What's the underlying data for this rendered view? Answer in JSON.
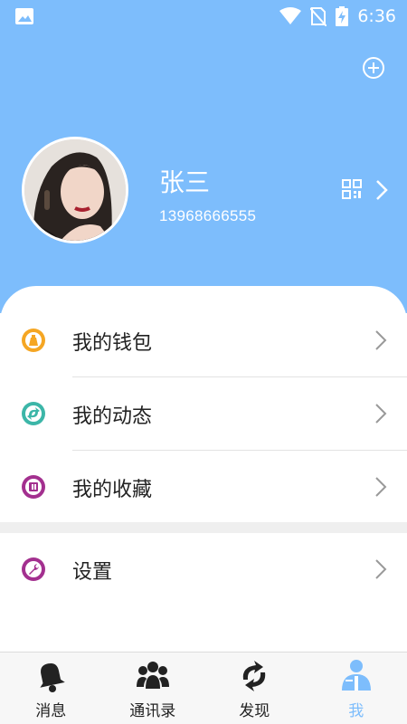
{
  "status_bar": {
    "time": "6:36"
  },
  "profile": {
    "name": "张三",
    "phone": "13968666555"
  },
  "menu": [
    {
      "label": "我的钱包",
      "icon": "wallet-icon",
      "color": "#f5a623"
    },
    {
      "label": "我的动态",
      "icon": "moments-icon",
      "color": "#3cb6a8"
    },
    {
      "label": "我的收藏",
      "icon": "favorites-icon",
      "color": "#a3308f"
    },
    {
      "label": "设置",
      "icon": "settings-icon",
      "color": "#a3308f"
    }
  ],
  "tabs": [
    {
      "label": "消息",
      "icon": "bell-icon",
      "active": false
    },
    {
      "label": "通讯录",
      "icon": "contacts-icon",
      "active": false
    },
    {
      "label": "发现",
      "icon": "discover-icon",
      "active": false
    },
    {
      "label": "我",
      "icon": "me-icon",
      "active": true
    }
  ],
  "colors": {
    "accent": "#7dbdfc",
    "text": "#222222"
  }
}
